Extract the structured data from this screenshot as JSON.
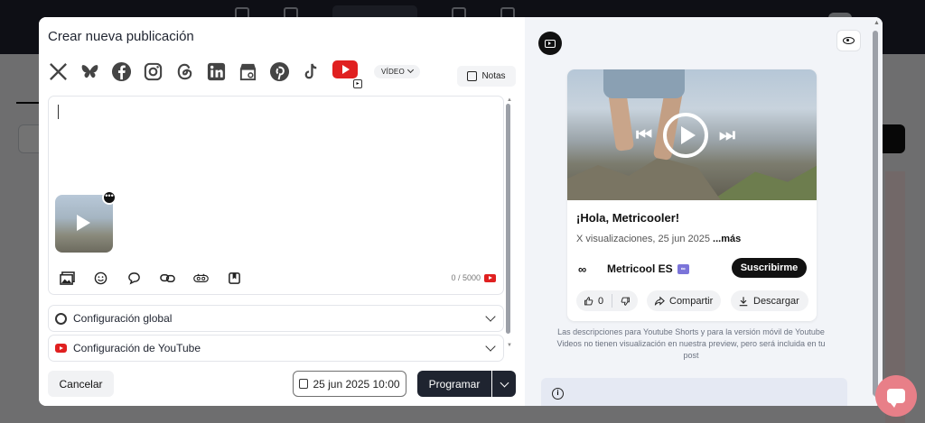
{
  "modal": {
    "title": "Crear nueva publicación",
    "networks": [
      "x-icon",
      "bluesky-icon",
      "facebook-icon",
      "instagram-icon",
      "threads-icon",
      "linkedin-icon",
      "google-business-icon",
      "pinterest-icon",
      "tiktok-icon",
      "youtube-icon"
    ],
    "video_type": "VÍDEO",
    "notes_label": "Notas",
    "editor": {
      "text": "",
      "char_count": "0 / 5000"
    },
    "accordions": {
      "global": "Configuración global",
      "youtube": "Configuración de YouTube"
    },
    "footer": {
      "cancel": "Cancelar",
      "date": "25 jun 2025 10:00",
      "schedule": "Programar"
    }
  },
  "preview": {
    "title": "¡Hola, Metricooler!",
    "meta": "X visualizaciones, 25 jun 2025",
    "more": "...más",
    "channel": "Metricool ES",
    "subscribe": "Suscribirme",
    "likes": "0",
    "share": "Compartir",
    "download": "Descargar",
    "note": "Las descripciones para Youtube Shorts y para la versión móvil de Youtube Videos no tienen visualización en nuestra preview, pero será incluida en tu post"
  },
  "colors": {
    "youtube_red": "#e02020",
    "dark_button": "#1f2430",
    "subscribe_bg": "#111111",
    "chat_fab": "#e87f88"
  }
}
